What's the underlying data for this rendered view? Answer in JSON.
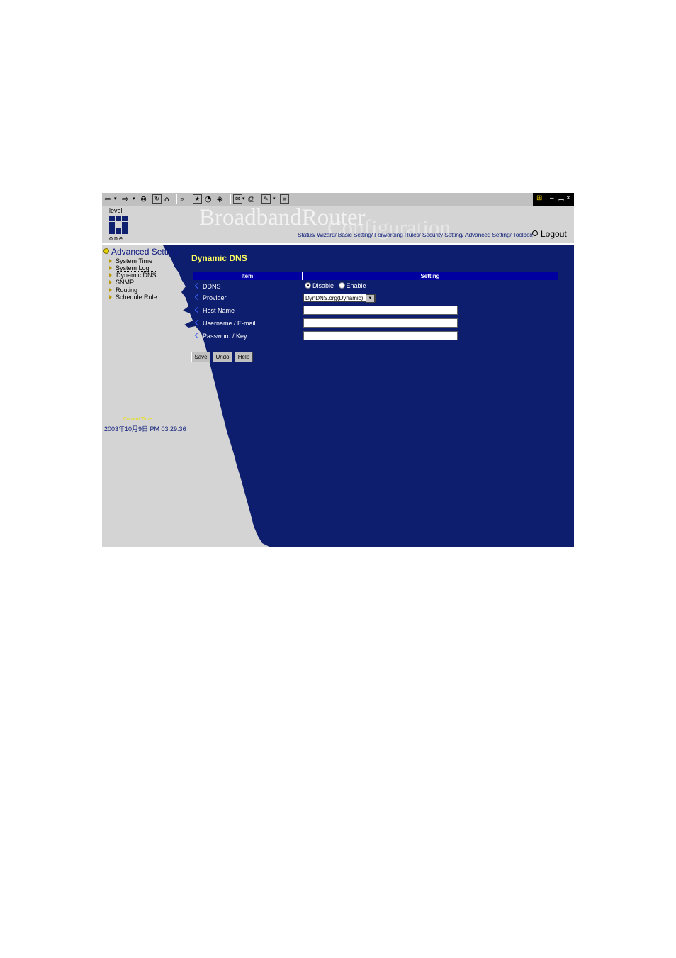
{
  "toolbar": {
    "icons": [
      "back-arrow-icon",
      "forward-arrow-icon",
      "stop-icon",
      "refresh-icon",
      "home-icon",
      "search-icon",
      "favorites-icon",
      "history-icon",
      "channels-icon",
      "mail-icon",
      "print-icon",
      "edit-icon",
      "discuss-icon"
    ]
  },
  "window": {
    "minimize": "–",
    "restore": "ꟷ",
    "close": "×"
  },
  "header": {
    "logo_top": "level",
    "logo_bottom": "one",
    "brand": "BroadbandRouter",
    "brand_sub": "Configuration",
    "nav": "Status/ Wizard/ Basic Setting/ Forwarding Rules/ Security Setting/ Advanced Setting/ Toolbox",
    "logout": "Logout"
  },
  "sidebar": {
    "title": "Advanced Setting",
    "items": [
      {
        "label": "System Time"
      },
      {
        "label": "System Log"
      },
      {
        "label": "Dynamic DNS"
      },
      {
        "label": "SNMP"
      },
      {
        "label": "Routing"
      },
      {
        "label": "Schedule Rule"
      }
    ],
    "current_time_label": "Current Time",
    "current_time": "2003年10月9日 PM 03:29:36"
  },
  "main": {
    "title": "Dynamic DNS",
    "col_item": "Item",
    "col_setting": "Setting",
    "rows": {
      "ddns": "DDNS",
      "provider": "Provider",
      "host": "Host Name",
      "user": "Username / E-mail",
      "pass": "Password / Key"
    },
    "ddns_disable": "Disable",
    "ddns_enable": "Enable",
    "provider_value": "DynDNS.org(Dynamic)",
    "buttons": {
      "save": "Save",
      "undo": "Undo",
      "help": "Help"
    }
  },
  "colors": {
    "page_blue": "#0e1e6e",
    "header_blue": "#0000a0",
    "title_yellow": "#ffff60",
    "panel_gray": "#d4d4d4"
  }
}
